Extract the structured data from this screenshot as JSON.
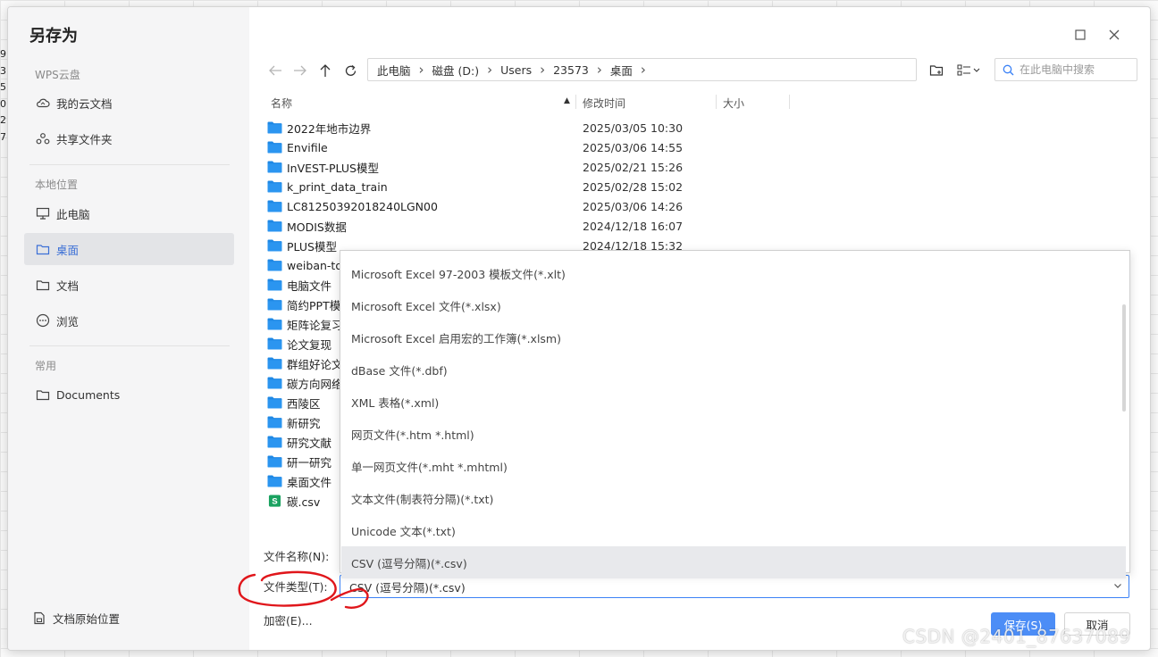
{
  "background": {
    "row_digits": [
      "9",
      "3",
      "5",
      "0",
      "2",
      "7"
    ]
  },
  "dialog": {
    "title": "另存为",
    "maximize_icon": "square-icon",
    "close_icon": "close-icon"
  },
  "sidebar": {
    "cloud_section": "WPS云盘",
    "cloud_items": [
      {
        "label": "我的云文档",
        "icon": "cloud-icon"
      },
      {
        "label": "共享文件夹",
        "icon": "share-icon"
      }
    ],
    "local_section": "本地位置",
    "local_items": [
      {
        "label": "此电脑",
        "icon": "monitor-icon"
      },
      {
        "label": "桌面",
        "icon": "folder-icon",
        "active": true
      },
      {
        "label": "文档",
        "icon": "folder-icon"
      },
      {
        "label": "浏览",
        "icon": "more-icon"
      }
    ],
    "common_section": "常用",
    "common_items": [
      {
        "label": "Documents",
        "icon": "folder-icon"
      }
    ],
    "footer": "文档原始位置"
  },
  "address": {
    "crumbs": [
      "此电脑",
      "磁盘 (D:)",
      "Users",
      "23573",
      "桌面"
    ]
  },
  "search": {
    "placeholder": "在此电脑中搜索"
  },
  "columns": {
    "name": "名称",
    "modified": "修改时间",
    "size": "大小"
  },
  "files": [
    {
      "name": "2022年地市边界",
      "date": "2025/03/05 10:30",
      "type": "folder"
    },
    {
      "name": "Envifile",
      "date": "2025/03/06 14:55",
      "type": "folder"
    },
    {
      "name": "InVEST-PLUS模型",
      "date": "2025/02/21 15:26",
      "type": "folder"
    },
    {
      "name": "k_print_data_train",
      "date": "2025/02/28 15:02",
      "type": "folder"
    },
    {
      "name": "LC81250392018240LGN00",
      "date": "2025/03/06 14:26",
      "type": "folder"
    },
    {
      "name": "MODIS数据",
      "date": "2024/12/18 16:07",
      "type": "folder"
    },
    {
      "name": "PLUS模型",
      "date": "2024/12/18 15:32",
      "type": "folder"
    },
    {
      "name": "weiban-to",
      "date": "",
      "type": "folder"
    },
    {
      "name": "电脑文件",
      "date": "",
      "type": "folder"
    },
    {
      "name": "简约PPT模",
      "date": "",
      "type": "folder"
    },
    {
      "name": "矩阵论复习",
      "date": "",
      "type": "folder"
    },
    {
      "name": "论文复现",
      "date": "",
      "type": "folder"
    },
    {
      "name": "群组好论文",
      "date": "",
      "type": "folder"
    },
    {
      "name": "碳方向网络",
      "date": "",
      "type": "folder"
    },
    {
      "name": "西陵区",
      "date": "",
      "type": "folder"
    },
    {
      "name": "新研究",
      "date": "",
      "type": "folder"
    },
    {
      "name": "研究文献",
      "date": "",
      "type": "folder"
    },
    {
      "name": "研一研究",
      "date": "",
      "type": "folder"
    },
    {
      "name": "桌面文件",
      "date": "",
      "type": "folder"
    },
    {
      "name": "碳.csv",
      "date": "",
      "type": "spreadsheet"
    }
  ],
  "filename": {
    "label": "文件名称(N):",
    "value": ""
  },
  "filetype": {
    "label": "文件类型(T):",
    "value": "CSV (逗号分隔)(*.csv)",
    "options": [
      "Microsoft Excel 97-2003 模板文件(*.xlt)",
      "Microsoft Excel 文件(*.xlsx)",
      "Microsoft Excel 启用宏的工作簿(*.xlsm)",
      "dBase 文件(*.dbf)",
      "XML 表格(*.xml)",
      "网页文件(*.htm *.html)",
      "单一网页文件(*.mht *.mhtml)",
      "文本文件(制表符分隔)(*.txt)",
      "Unicode 文本(*.txt)",
      "CSV (逗号分隔)(*.csv)"
    ],
    "selected_index": 9
  },
  "encrypt_label": "加密(E)...",
  "buttons": {
    "save": "保存(S)",
    "cancel": "取消"
  },
  "watermark": "CSDN @2401_87637089",
  "colors": {
    "accent": "#4c8df6",
    "folder": "#1e88e5",
    "spreadsheet": "#1aa260",
    "annotation": "#e0161b"
  }
}
